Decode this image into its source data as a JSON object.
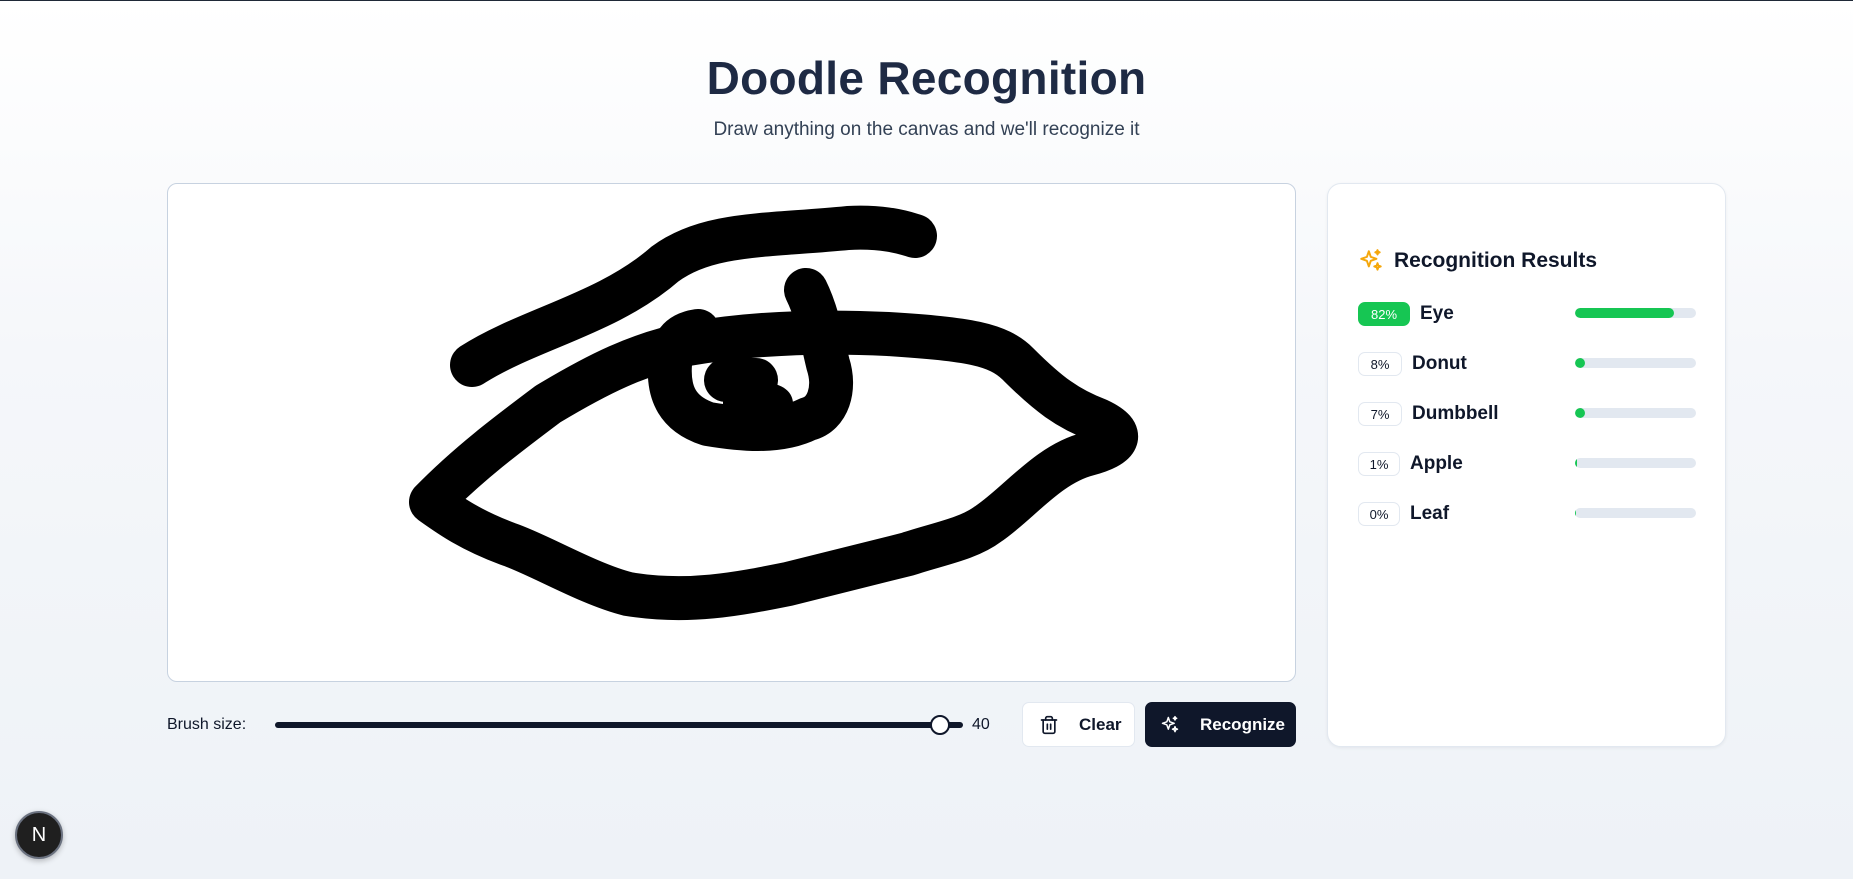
{
  "header": {
    "title": "Doodle Recognition",
    "subtitle": "Draw anything on the canvas and we'll recognize it"
  },
  "controls": {
    "brush_label": "Brush size:",
    "brush_value": "40",
    "brush_level": 0.98,
    "clear_label": "Clear",
    "recognize_label": "Recognize"
  },
  "results": {
    "title": "Recognition Results",
    "items": [
      {
        "percent_label": "82%",
        "label": "Eye",
        "value": 0.82,
        "top": true
      },
      {
        "percent_label": "8%",
        "label": "Donut",
        "value": 0.08,
        "top": false
      },
      {
        "percent_label": "7%",
        "label": "Dumbbell",
        "value": 0.07,
        "top": false
      },
      {
        "percent_label": "1%",
        "label": "Apple",
        "value": 0.01,
        "top": false
      },
      {
        "percent_label": "0%",
        "label": "Leaf",
        "value": 0.0,
        "top": false
      }
    ]
  },
  "colors": {
    "accent": "#16c653",
    "primary_button": "#0f172a",
    "sparkle_icon": "#f5a70b",
    "track": "#e2e8f0"
  },
  "icons": {
    "results": "sparkles-icon",
    "clear": "trash-icon",
    "recognize": "sparkles-icon",
    "dev_badge": "nextjs-icon"
  },
  "dev_badge": {
    "letter": "N"
  }
}
